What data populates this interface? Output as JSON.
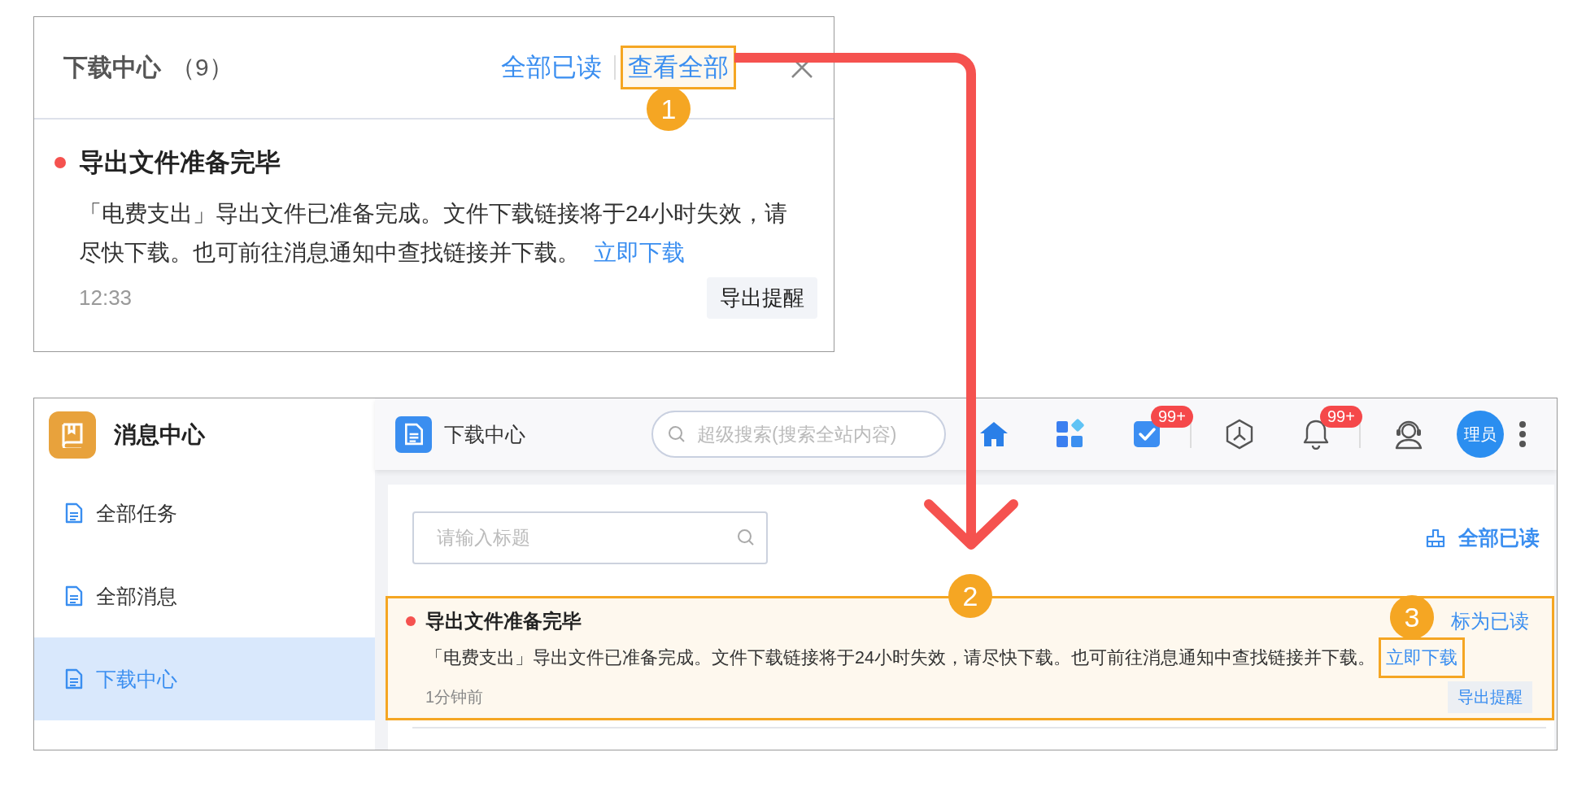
{
  "popup": {
    "title": "下载中心",
    "count": "（9）",
    "actions": [
      {
        "label": "全部已读",
        "highlighted": false
      },
      {
        "label": "查看全部",
        "highlighted": true
      }
    ],
    "message": {
      "unread": true,
      "title": "导出文件准备完毕",
      "body": "「电费支出」导出文件已准备完成。文件下载链接将于24小时失效，请尽快下载。也可前往消息通知中查找链接并下载。",
      "link": {
        "label": "立即下载",
        "highlighted": false
      },
      "time": "12:33",
      "tag": "导出提醒"
    }
  },
  "app": {
    "sidebar": {
      "title": "消息中心",
      "items": [
        {
          "label": "全部任务",
          "selected": false
        },
        {
          "label": "全部消息",
          "selected": false
        },
        {
          "label": "下载中心",
          "selected": true
        }
      ]
    },
    "topbar": {
      "page_title": "下载中心",
      "search": {
        "placeholder": "超级搜索(搜索全站内容)"
      },
      "icons": [
        {
          "kind": "home",
          "separator": false
        },
        {
          "kind": "apps",
          "separator": false
        },
        {
          "kind": "tasks",
          "badge": "99+",
          "separator": true
        },
        {
          "kind": "hexagon",
          "separator": false
        },
        {
          "kind": "bell",
          "badge": "99+",
          "separator": true
        },
        {
          "kind": "support",
          "separator": false
        }
      ],
      "avatar": "理员"
    },
    "filter": {
      "placeholder": "请输入标题"
    },
    "mark_all_read": "全部已读",
    "messages": [
      {
        "unread": true,
        "highlighted": true,
        "title": "导出文件准备完毕",
        "body": "「电费支出」导出文件已准备完成。文件下载链接将于24小时失效，请尽快下载。也可前往消息通知中查找链接并下载。",
        "link": {
          "label": "立即下载",
          "highlighted": true
        },
        "mark_read": "标为已读",
        "time": "1分钟前",
        "tag": "导出提醒"
      }
    ]
  },
  "markers": [
    "1",
    "2",
    "3"
  ]
}
